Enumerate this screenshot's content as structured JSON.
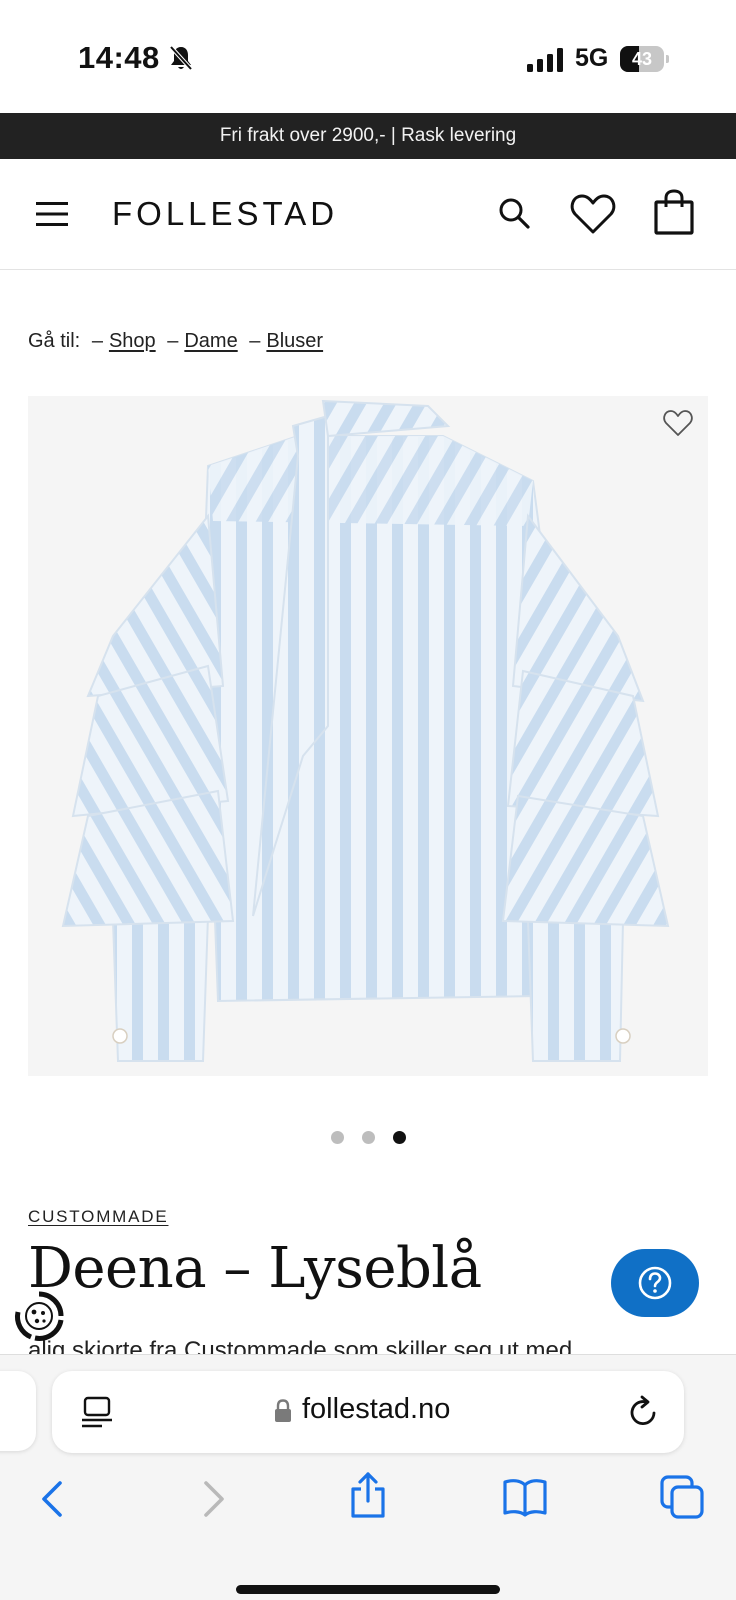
{
  "status_bar": {
    "time": "14:48",
    "network": "5G",
    "battery_level": "43",
    "battery_fraction": 0.43,
    "icons": [
      "bell-slash-icon",
      "signal-icon"
    ]
  },
  "promo_banner": {
    "text": "Fri frakt over 2900,- | Rask levering"
  },
  "header": {
    "logo": "FOLLESTAD",
    "icons": [
      "menu-icon",
      "search-icon",
      "heart-icon",
      "bag-icon"
    ]
  },
  "breadcrumb": {
    "prefix": "Gå til:",
    "separator": "–",
    "items": [
      "Shop",
      "Dame",
      "Bluser"
    ]
  },
  "product": {
    "image_alt": "Deena – Lyseblå",
    "colors": {
      "stripe": "#c9dcef",
      "fabric": "#eef4fa",
      "background": "#f5f5f5"
    },
    "carousel": {
      "count": 3,
      "active_index": 2
    },
    "brand": "CUSTOMMADE",
    "title": "Deena – Lyseblå",
    "description": "alig skjorte fra Custommade som skiller seg ut med"
  },
  "help_button": {
    "icon": "question-icon",
    "color": "#1070c6"
  },
  "browser": {
    "url": "follestad.no",
    "icons": [
      "reader-icon",
      "lock-icon",
      "reload-icon",
      "back-icon",
      "forward-icon",
      "share-icon",
      "bookmarks-icon",
      "tabs-icon"
    ],
    "accent": "#1a73e8"
  }
}
